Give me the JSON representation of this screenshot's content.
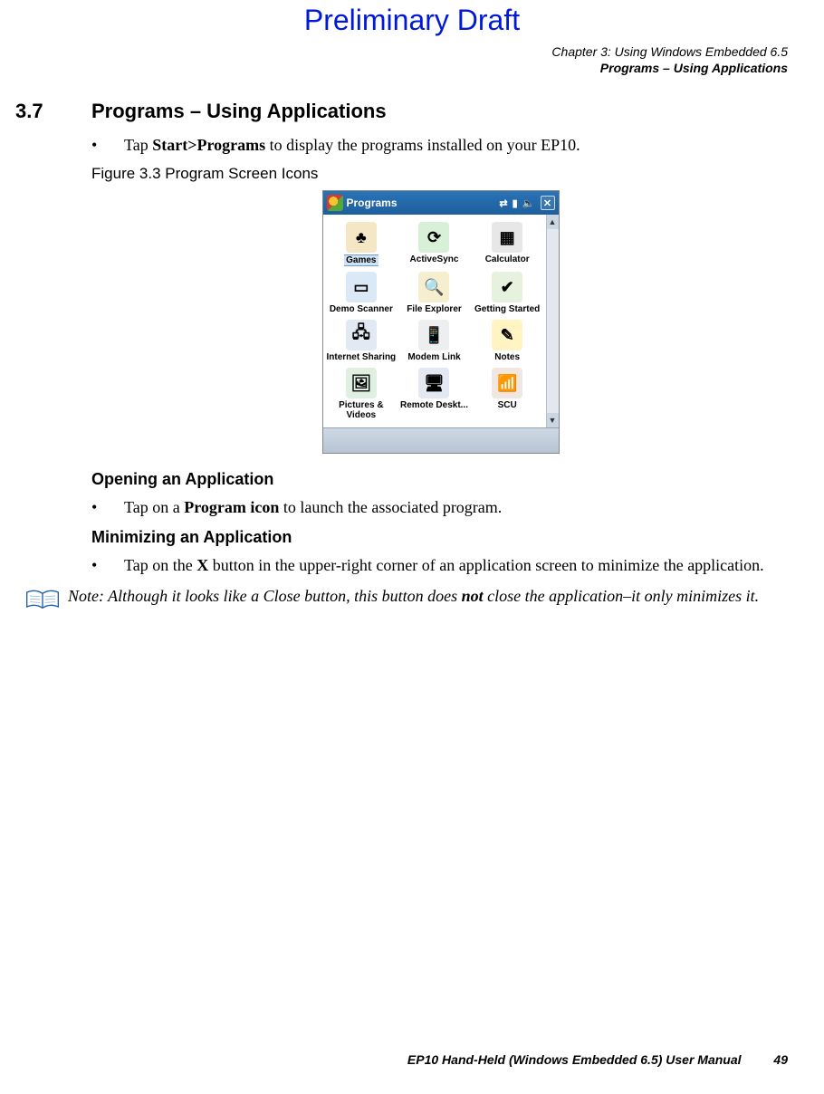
{
  "watermark": "Preliminary Draft",
  "header": {
    "line1": "Chapter 3:  Using Windows Embedded 6.5",
    "line2": "Programs – Using Applications"
  },
  "section": {
    "number": "3.7",
    "title": "Programs – Using Applications"
  },
  "intro": {
    "pre": "Tap ",
    "bold": "Start>Programs",
    "post": " to display the programs installed on your EP10."
  },
  "figure_caption": "Figure 3.3  Program Screen Icons",
  "device": {
    "title": "Programs",
    "close": "✕",
    "apps": [
      {
        "name": "Games",
        "bg": "#f4e7c6",
        "glyph": "♣"
      },
      {
        "name": "ActiveSync",
        "bg": "#d8f0d8",
        "glyph": "⟳"
      },
      {
        "name": "Calculator",
        "bg": "#e7e7e7",
        "glyph": "▦"
      },
      {
        "name": "Demo Scanner",
        "bg": "#dbe9f6",
        "glyph": "▭"
      },
      {
        "name": "File Explorer",
        "bg": "#f6efcf",
        "glyph": "🔍"
      },
      {
        "name": "Getting Started",
        "bg": "#e6f2dd",
        "glyph": "✔"
      },
      {
        "name": "Internet Sharing",
        "bg": "#e2e9f3",
        "glyph": "🖧"
      },
      {
        "name": "Modem Link",
        "bg": "#eceef0",
        "glyph": "📱"
      },
      {
        "name": "Notes",
        "bg": "#fff4c2",
        "glyph": "✎"
      },
      {
        "name": "Pictures & Videos",
        "bg": "#dff0e2",
        "glyph": "🖼"
      },
      {
        "name": "Remote Deskt...",
        "bg": "#e3e8f2",
        "glyph": "🖥"
      },
      {
        "name": "SCU",
        "bg": "#efe7e0",
        "glyph": "📶"
      }
    ]
  },
  "sub1": {
    "title": "Opening an Application",
    "pre": "Tap on a ",
    "bold": "Program icon",
    "post": " to launch the associated program."
  },
  "sub2": {
    "title": "Minimizing an Application",
    "pre": "Tap on the ",
    "bold": "X",
    "post": " button in the upper-right corner of an application screen to minimize the application."
  },
  "note": {
    "label": "Note: ",
    "t1": "Although it looks like a Close button, this button does ",
    "not": "not",
    "t2": " close the application–it only minimizes it."
  },
  "footer": {
    "text": "EP10 Hand-Held (Windows Embedded 6.5) User Manual",
    "page": "49"
  }
}
